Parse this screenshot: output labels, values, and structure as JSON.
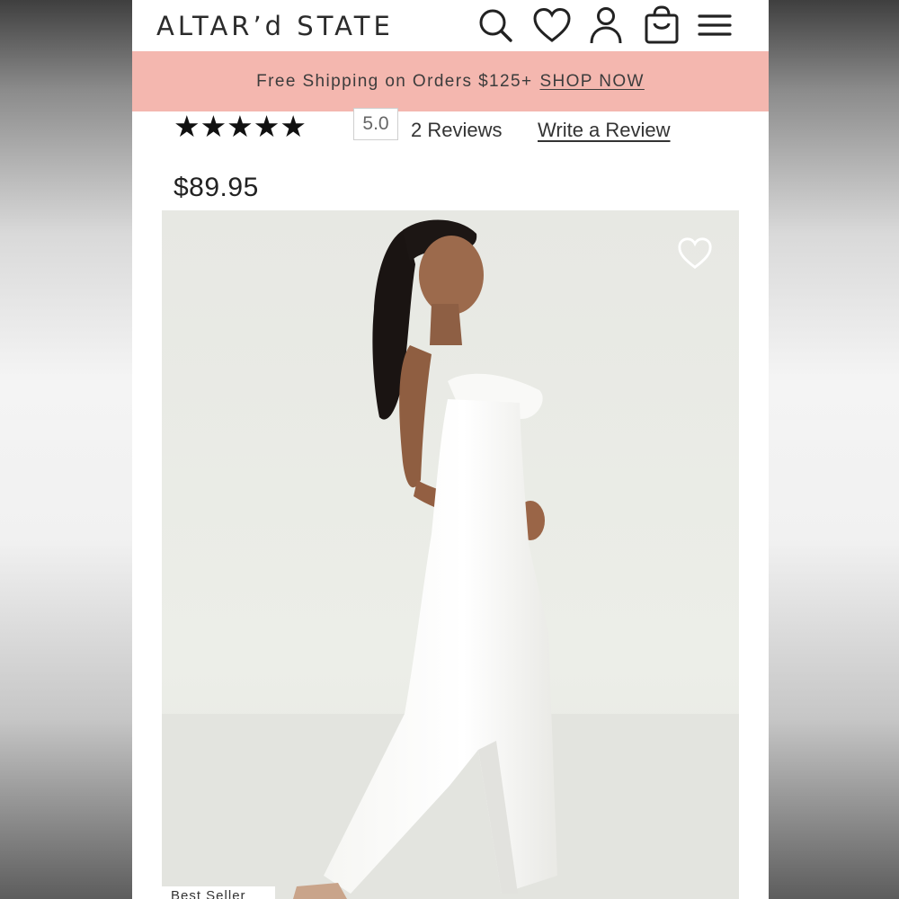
{
  "header": {
    "logo": "ALTAR’d STATE",
    "icons": [
      "search-icon",
      "heart-icon",
      "account-icon",
      "bag-icon",
      "menu-icon"
    ]
  },
  "banner": {
    "text": "Free Shipping on Orders $125+",
    "link": "SHOP NOW"
  },
  "product": {
    "stars": "★★★★★",
    "rating": "5.0",
    "reviews": "2 Reviews",
    "write_review": "Write a Review",
    "price": "$89.95",
    "badge": "Best Seller",
    "image_alt": "Model wearing white strapless jumpsuit with feather trim"
  },
  "colors": {
    "banner": "#f4b7af",
    "text": "#2b2b2b"
  }
}
